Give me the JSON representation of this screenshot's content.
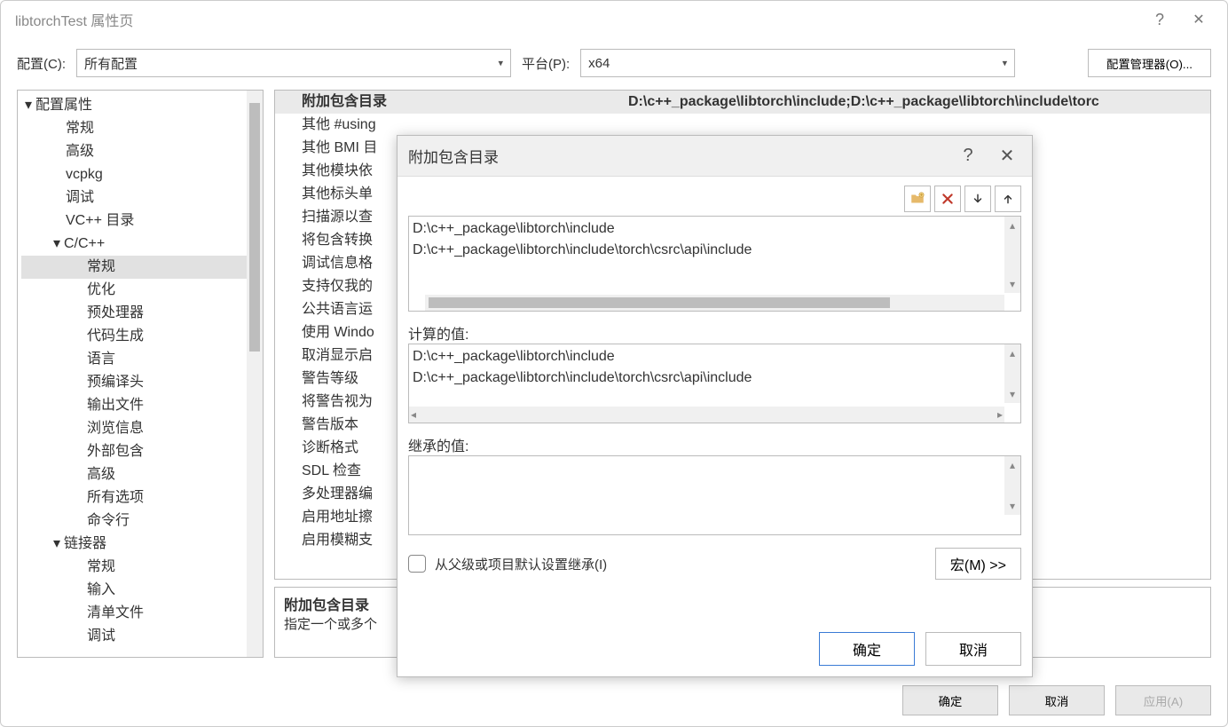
{
  "window": {
    "title": "libtorchTest 属性页",
    "help_icon": "?",
    "close_icon": "✕"
  },
  "topbar": {
    "config_label": "配置(C):",
    "config_value": "所有配置",
    "platform_label": "平台(P):",
    "platform_value": "x64",
    "cfg_mgr_btn": "配置管理器(O)..."
  },
  "tree": {
    "items": [
      {
        "level": 1,
        "expand": "▾",
        "label": "配置属性"
      },
      {
        "level": 2,
        "label": "常规"
      },
      {
        "level": 2,
        "label": "高级"
      },
      {
        "level": 2,
        "label": "vcpkg"
      },
      {
        "level": 2,
        "label": "调试"
      },
      {
        "level": 2,
        "label": "VC++ 目录"
      },
      {
        "level": 2,
        "expand": "▾",
        "label": "C/C++"
      },
      {
        "level": 3,
        "label": "常规",
        "selected": true
      },
      {
        "level": 3,
        "label": "优化"
      },
      {
        "level": 3,
        "label": "预处理器"
      },
      {
        "level": 3,
        "label": "代码生成"
      },
      {
        "level": 3,
        "label": "语言"
      },
      {
        "level": 3,
        "label": "预编译头"
      },
      {
        "level": 3,
        "label": "输出文件"
      },
      {
        "level": 3,
        "label": "浏览信息"
      },
      {
        "level": 3,
        "label": "外部包含"
      },
      {
        "level": 3,
        "label": "高级"
      },
      {
        "level": 3,
        "label": "所有选项"
      },
      {
        "level": 3,
        "label": "命令行"
      },
      {
        "level": 2,
        "expand": "▾",
        "label": "链接器"
      },
      {
        "level": 3,
        "label": "常规"
      },
      {
        "level": 3,
        "label": "输入"
      },
      {
        "level": 3,
        "label": "清单文件"
      },
      {
        "level": 3,
        "label": "调试"
      }
    ]
  },
  "grid": {
    "rows": [
      {
        "k": "附加包含目录",
        "v": "D:\\c++_package\\libtorch\\include;D:\\c++_package\\libtorch\\include\\torc",
        "selected": true
      },
      {
        "k": "其他 #using"
      },
      {
        "k": "其他 BMI 目"
      },
      {
        "k": "其他模块依"
      },
      {
        "k": "其他标头单"
      },
      {
        "k": "扫描源以查"
      },
      {
        "k": "将包含转换"
      },
      {
        "k": "调试信息格"
      },
      {
        "k": "支持仅我的"
      },
      {
        "k": "公共语言运"
      },
      {
        "k": "使用 Windo"
      },
      {
        "k": "取消显示启"
      },
      {
        "k": "警告等级"
      },
      {
        "k": "将警告视为"
      },
      {
        "k": "警告版本"
      },
      {
        "k": "诊断格式"
      },
      {
        "k": "SDL 检查"
      },
      {
        "k": "多处理器编"
      },
      {
        "k": "启用地址擦"
      },
      {
        "k": "启用模糊支"
      }
    ]
  },
  "desc": {
    "title": "附加包含目录",
    "text": "指定一个或多个"
  },
  "footer": {
    "ok": "确定",
    "cancel": "取消",
    "apply": "应用(A)"
  },
  "dialog": {
    "title": "附加包含目录",
    "help": "?",
    "close": "✕",
    "list": [
      "D:\\c++_package\\libtorch\\include",
      "D:\\c++_package\\libtorch\\include\\torch\\csrc\\api\\include"
    ],
    "calc_label": "计算的值:",
    "calc": [
      "D:\\c++_package\\libtorch\\include",
      "D:\\c++_package\\libtorch\\include\\torch\\csrc\\api\\include"
    ],
    "inherit_label": "继承的值:",
    "inherit_chk_label": "从父级或项目默认设置继承(I)",
    "macros_btn": "宏(M) >>",
    "ok": "确定",
    "cancel": "取消"
  }
}
